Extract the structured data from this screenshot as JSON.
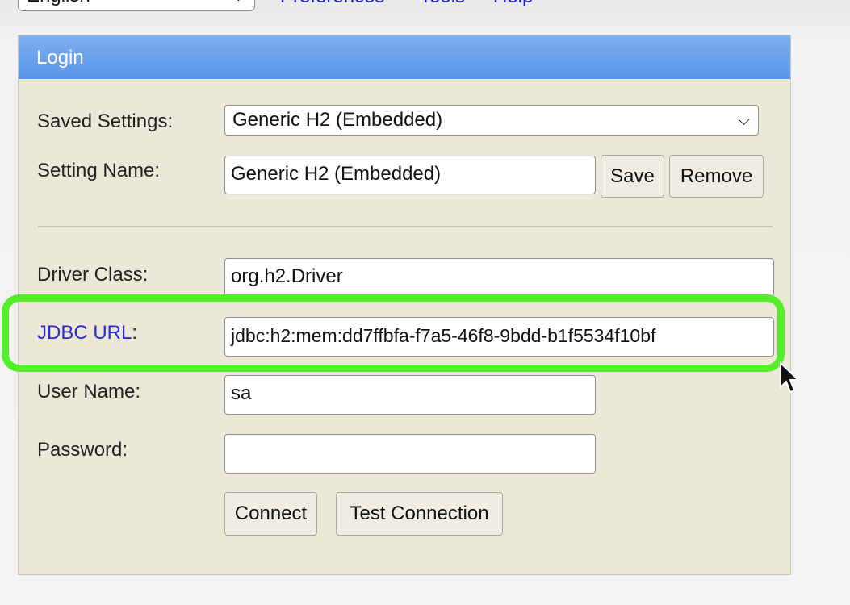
{
  "topbar": {
    "language": "English",
    "links": [
      "Preferences",
      "Tools",
      "Help"
    ]
  },
  "login": {
    "title": "Login",
    "saved_settings_label": "Saved Settings:",
    "saved_settings_value": "Generic H2 (Embedded)",
    "setting_name_label": "Setting Name:",
    "setting_name_value": "Generic H2 (Embedded)",
    "save_label": "Save",
    "remove_label": "Remove",
    "driver_class_label": "Driver Class:",
    "driver_class_value": "org.h2.Driver",
    "jdbc_url_label": "JDBC URL",
    "jdbc_url_colon": ":",
    "jdbc_url_value": "jdbc:h2:mem:dd7ffbfa-f7a5-46f8-9bdd-b1f5534f10bf",
    "user_name_label": "User Name:",
    "user_name_value": "sa",
    "password_label": "Password:",
    "password_value": "",
    "connect_label": "Connect",
    "test_connection_label": "Test Connection"
  },
  "colors": {
    "header": "#5794e6",
    "panel": "#ebe8d8",
    "highlight": "#55ee2a",
    "link": "#2b2bd6"
  }
}
